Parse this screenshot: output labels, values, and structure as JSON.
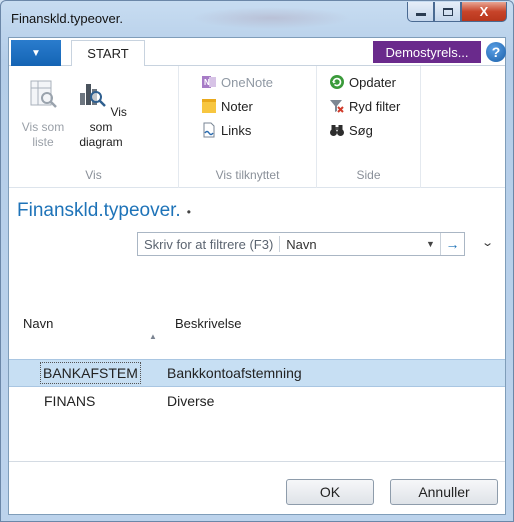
{
  "window": {
    "title": "Finanskld.typeover.",
    "minimize_glyph": "",
    "maximize_glyph": "",
    "close_glyph": "X"
  },
  "ribbon": {
    "file_tab_glyph": "▼",
    "start_tab": "START",
    "company": "Demostyrels...",
    "help_glyph": "?",
    "groups": {
      "vis": {
        "label": "Vis",
        "vis_som_liste": "Vis som liste",
        "vis_som_diagram": "Vis som diagram"
      },
      "vis_tilknyttet": {
        "label": "Vis tilknyttet",
        "onenote": "OneNote",
        "noter": "Noter",
        "links": "Links"
      },
      "side": {
        "label": "Side",
        "opdater": "Opdater",
        "ryd_filter": "Ryd filter",
        "sog": "Søg"
      }
    }
  },
  "page": {
    "caption": "Finanskld.typeover.",
    "caption_marker": "•"
  },
  "filter": {
    "placeholder": "Skriv for at filtrere (F3)",
    "field": "Navn",
    "dropdown_glyph": "▼",
    "go_glyph": "→",
    "collapse_glyph": "⌄"
  },
  "list": {
    "columns": [
      "Navn",
      "Beskrivelse"
    ],
    "sort_glyph": "▲",
    "rows": [
      {
        "navn": "BANKAFSTEM",
        "beskrivelse": "Bankkontoafstemning",
        "selected": true
      },
      {
        "navn": "FINANS",
        "beskrivelse": "Diverse",
        "selected": false
      }
    ]
  },
  "buttons": {
    "ok": "OK",
    "cancel": "Annuller"
  },
  "colors": {
    "accent": "#1e73b8",
    "company_badge": "#6a2a8c",
    "selected_row": "#c7dff3",
    "close_button": "#c7442a"
  }
}
